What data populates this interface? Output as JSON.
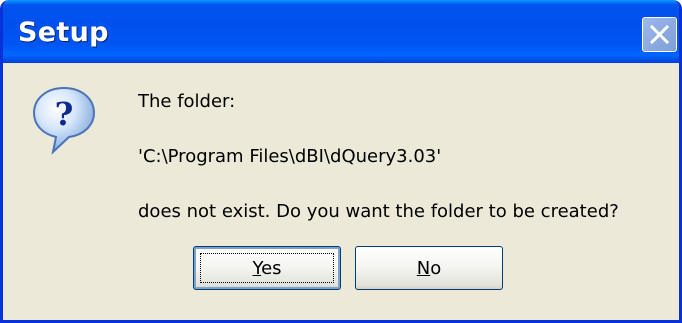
{
  "window": {
    "title": "Setup"
  },
  "dialog": {
    "icon": "question-icon",
    "lines": [
      "The folder:",
      "'C:\\Program Files\\dBI\\dQuery3.03'",
      "does not exist.  Do you want the folder to be created?"
    ],
    "buttons": {
      "yes": {
        "mnemonic": "Y",
        "rest": "es"
      },
      "no": {
        "mnemonic": "N",
        "rest": "o"
      }
    }
  },
  "colors": {
    "titlebar": "#0054e3",
    "face": "#ece9d8",
    "border": "#0831d9"
  }
}
